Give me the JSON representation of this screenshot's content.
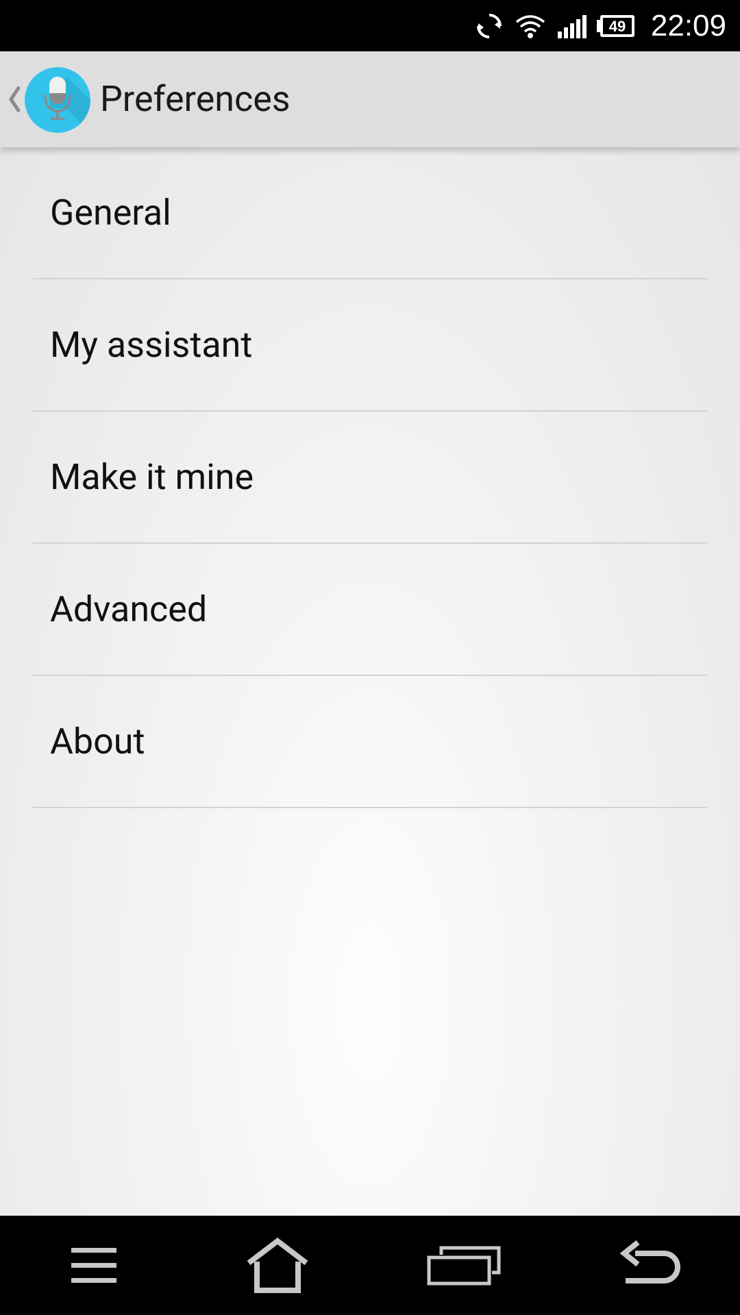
{
  "status_bar": {
    "time": "22:09",
    "battery_level": "49",
    "icons": [
      "sync-icon",
      "wifi-icon",
      "cell-signal-icon",
      "battery-icon"
    ]
  },
  "action_bar": {
    "title": "Preferences",
    "logo_icon": "microphone-icon",
    "accent_color": "#33c3ea"
  },
  "menu": {
    "items": [
      {
        "label": "General"
      },
      {
        "label": "My assistant"
      },
      {
        "label": "Make it mine"
      },
      {
        "label": "Advanced"
      },
      {
        "label": "About"
      }
    ]
  },
  "nav_bar": {
    "buttons": [
      "menu-icon",
      "home-icon",
      "recent-apps-icon",
      "back-icon"
    ]
  }
}
